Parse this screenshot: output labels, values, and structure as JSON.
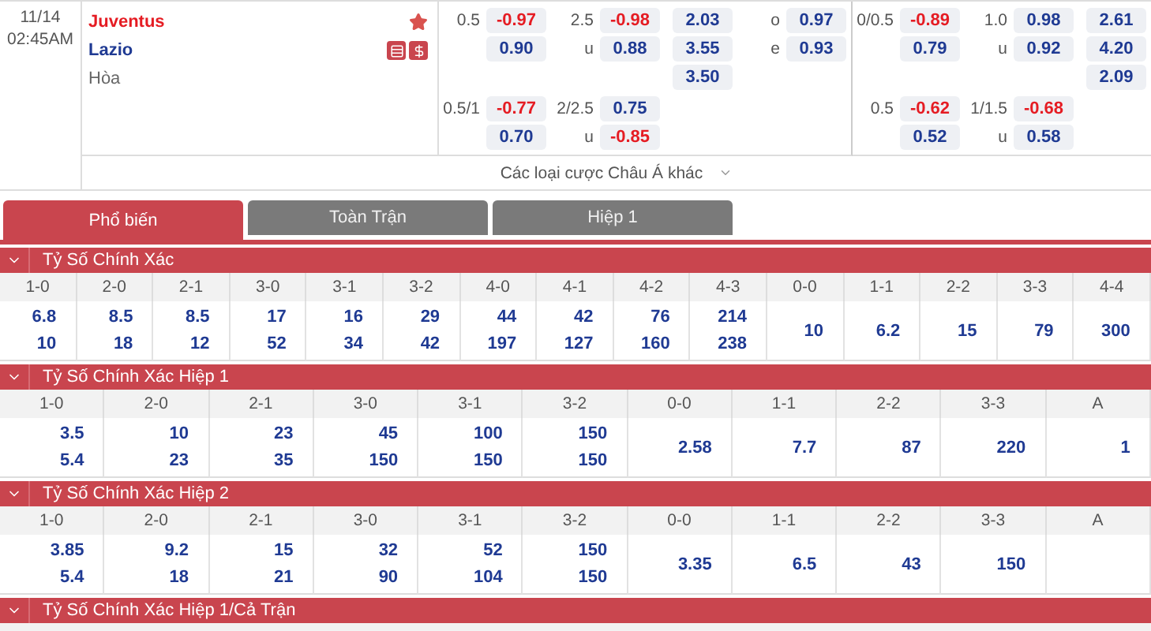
{
  "match": {
    "date": "11/14",
    "time": "02:45AM",
    "home": "Juventus",
    "away": "Lazio",
    "draw": "Hòa",
    "favorite": true
  },
  "full_time": [
    {
      "handicap": [
        {
          "label": "0.5",
          "price": "-0.97"
        },
        {
          "price": "0.90"
        }
      ],
      "total": [
        {
          "label": "2.5",
          "price": "-0.98"
        },
        {
          "label": "u",
          "price": "0.88"
        }
      ],
      "result": [
        {
          "price": "2.03"
        },
        {
          "price": "3.55"
        },
        {
          "price": "3.50"
        }
      ],
      "odd_even": [
        {
          "label": "o",
          "price": "0.97"
        },
        {
          "label": "e",
          "price": "0.93"
        }
      ]
    },
    {
      "handicap": [
        {
          "label": "0.5/1",
          "price": "-0.77"
        },
        {
          "price": "0.70"
        }
      ],
      "total": [
        {
          "label": "2/2.5",
          "price": "0.75"
        },
        {
          "label": "u",
          "price": "-0.85"
        }
      ]
    }
  ],
  "first_half": [
    {
      "handicap": [
        {
          "label": "0/0.5",
          "price": "-0.89"
        },
        {
          "price": "0.79"
        }
      ],
      "total": [
        {
          "label": "1.0",
          "price": "0.98"
        },
        {
          "label": "u",
          "price": "0.92"
        }
      ],
      "result": [
        {
          "price": "2.61"
        },
        {
          "price": "4.20"
        },
        {
          "price": "2.09"
        }
      ]
    },
    {
      "handicap": [
        {
          "label": "0.5",
          "price": "-0.62"
        },
        {
          "price": "0.52"
        }
      ],
      "total": [
        {
          "label": "1/1.5",
          "price": "-0.68"
        },
        {
          "label": "u",
          "price": "0.58"
        }
      ]
    }
  ],
  "more_link": "Các loại cược Châu Á khác",
  "tabs": [
    {
      "label": "Phổ biến",
      "selected": true
    },
    {
      "label": "Toàn Trận",
      "selected": false
    },
    {
      "label": "Hiệp 1",
      "selected": false
    }
  ],
  "sections": [
    {
      "title": "Tỷ Số Chính Xác",
      "expanded": true,
      "columns": [
        {
          "header": "1-0",
          "values": [
            "6.8",
            "10"
          ]
        },
        {
          "header": "2-0",
          "values": [
            "8.5",
            "18"
          ]
        },
        {
          "header": "2-1",
          "values": [
            "8.5",
            "12"
          ]
        },
        {
          "header": "3-0",
          "values": [
            "17",
            "52"
          ]
        },
        {
          "header": "3-1",
          "values": [
            "16",
            "34"
          ]
        },
        {
          "header": "3-2",
          "values": [
            "29",
            "42"
          ]
        },
        {
          "header": "4-0",
          "values": [
            "44",
            "197"
          ]
        },
        {
          "header": "4-1",
          "values": [
            "42",
            "127"
          ]
        },
        {
          "header": "4-2",
          "values": [
            "76",
            "160"
          ]
        },
        {
          "header": "4-3",
          "values": [
            "214",
            "238"
          ]
        },
        {
          "header": "0-0",
          "values": [
            "10"
          ]
        },
        {
          "header": "1-1",
          "values": [
            "6.2"
          ]
        },
        {
          "header": "2-2",
          "values": [
            "15"
          ]
        },
        {
          "header": "3-3",
          "values": [
            "79"
          ]
        },
        {
          "header": "4-4",
          "values": [
            "300"
          ]
        }
      ]
    },
    {
      "title": "Tỷ Số Chính Xác Hiệp 1",
      "expanded": true,
      "columns": [
        {
          "header": "1-0",
          "values": [
            "3.5",
            "5.4"
          ]
        },
        {
          "header": "2-0",
          "values": [
            "10",
            "23"
          ]
        },
        {
          "header": "2-1",
          "values": [
            "23",
            "35"
          ]
        },
        {
          "header": "3-0",
          "values": [
            "45",
            "150"
          ]
        },
        {
          "header": "3-1",
          "values": [
            "100",
            "150"
          ]
        },
        {
          "header": "3-2",
          "values": [
            "150",
            "150"
          ]
        },
        {
          "header": "0-0",
          "values": [
            "2.58"
          ]
        },
        {
          "header": "1-1",
          "values": [
            "7.7"
          ]
        },
        {
          "header": "2-2",
          "values": [
            "87"
          ]
        },
        {
          "header": "3-3",
          "values": [
            "220"
          ]
        },
        {
          "header": "A",
          "values": [
            "1"
          ]
        }
      ]
    },
    {
      "title": "Tỷ Số Chính Xác Hiệp 2",
      "expanded": true,
      "columns": [
        {
          "header": "1-0",
          "values": [
            "3.85",
            "5.4"
          ]
        },
        {
          "header": "2-0",
          "values": [
            "9.2",
            "18"
          ]
        },
        {
          "header": "2-1",
          "values": [
            "15",
            "21"
          ]
        },
        {
          "header": "3-0",
          "values": [
            "32",
            "90"
          ]
        },
        {
          "header": "3-1",
          "values": [
            "52",
            "104"
          ]
        },
        {
          "header": "3-2",
          "values": [
            "150",
            "150"
          ]
        },
        {
          "header": "0-0",
          "values": [
            "3.35"
          ]
        },
        {
          "header": "1-1",
          "values": [
            "6.5"
          ]
        },
        {
          "header": "2-2",
          "values": [
            "43"
          ]
        },
        {
          "header": "3-3",
          "values": [
            "150"
          ]
        },
        {
          "header": "A"
        }
      ]
    },
    {
      "title": "Tỷ Số Chính Xác Hiệp 1/Cả Trận",
      "expanded": true
    }
  ]
}
